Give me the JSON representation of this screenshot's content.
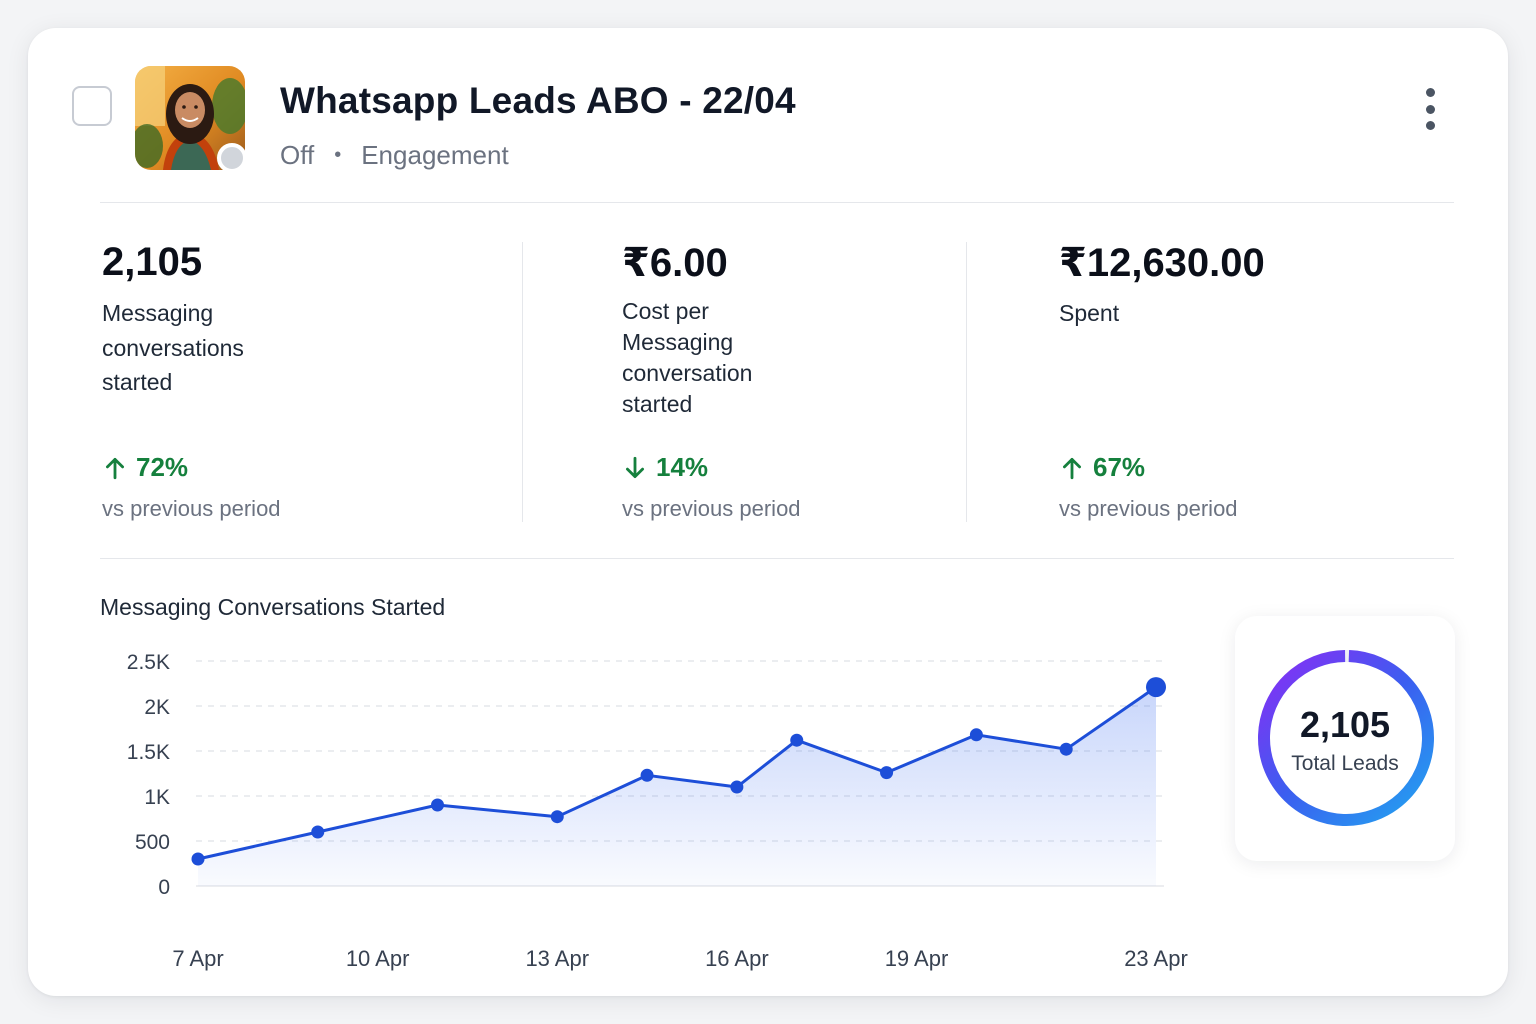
{
  "campaign": {
    "title": "Whatsapp Leads ABO - 22/04",
    "status": "Off",
    "objective": "Engagement"
  },
  "colors": {
    "accent": "#1d4ed8",
    "positive": "#15803d",
    "ring_start": "#3b82f6",
    "ring_end": "#8b2cf5"
  },
  "icons": {
    "checkbox": "checkbox-icon",
    "menu": "kebab-menu-icon",
    "up": "arrow-up-icon",
    "down": "arrow-down-icon"
  },
  "metrics": [
    {
      "value": "2,105",
      "label_lines": [
        "Messaging",
        "conversations",
        "started"
      ],
      "change": "72%",
      "direction": "up",
      "compare": "vs previous period"
    },
    {
      "value": "₹6.00",
      "label_lines": [
        "Cost per",
        "Messaging",
        "conversation",
        "started"
      ],
      "change": "14%",
      "direction": "down",
      "compare": "vs previous period"
    },
    {
      "value": "₹12,630.00",
      "label_lines": [
        "Spent"
      ],
      "change": "67%",
      "direction": "up",
      "compare": "vs previous period"
    }
  ],
  "total_leads": {
    "value": "2,105",
    "label": "Total Leads",
    "ring_fraction": 1.0
  },
  "chart_data": {
    "type": "line",
    "title": "Messaging Conversations Started",
    "xlabel": "",
    "ylabel": "",
    "ylim": [
      0,
      2500
    ],
    "y_ticks": [
      "0",
      "500",
      "1K",
      "1.5K",
      "2K",
      "2.5K"
    ],
    "y_tick_values": [
      0,
      500,
      1000,
      1500,
      2000,
      2500
    ],
    "x_tick_labels": [
      "7 Apr",
      "10 Apr",
      "13 Apr",
      "16 Apr",
      "19 Apr",
      "23 Apr"
    ],
    "x_tick_days": [
      7,
      10,
      13,
      16,
      19,
      23
    ],
    "x_days": [
      7,
      9,
      11,
      13,
      14.5,
      16,
      17,
      18.5,
      20,
      21.5,
      23
    ],
    "values": [
      300,
      600,
      900,
      770,
      1230,
      1100,
      1620,
      1260,
      1680,
      1520,
      2210
    ],
    "grid": true,
    "fill": true
  }
}
